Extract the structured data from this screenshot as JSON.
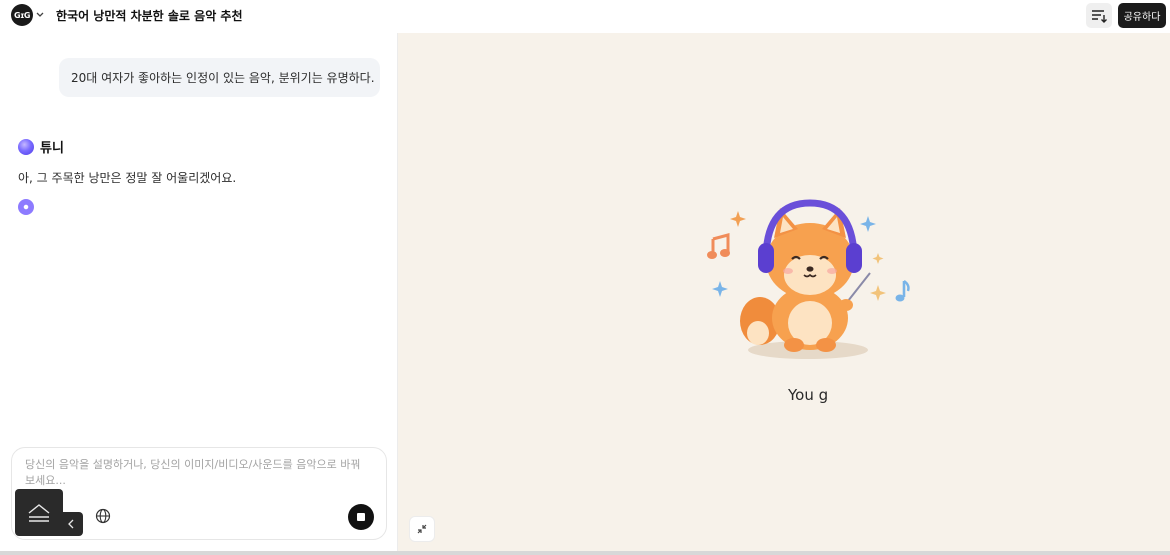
{
  "header": {
    "logo_text": "GɪG",
    "title": "한국어 낭만적 차분한 솔로 음악 추천",
    "share_label": "공유하다",
    "sort_icon": "sort-icon"
  },
  "chat": {
    "user_message": "20대 여자가 좋아하는 인정이 있는 음악, 분위기는 유명하다.",
    "bot_name": "튜니",
    "bot_message": "아, 그 주목한 낭만은 정말 잘 어울리겠어요."
  },
  "input": {
    "placeholder": "당신의 음악을 설명하거나, 당신의 이미지/비디오/사운드를 음악으로 바꿔 보세요...",
    "globe_icon": "globe-icon",
    "stop_icon": "stop-icon"
  },
  "preview": {
    "loading_text": "You g",
    "collapse_icon": "collapse-icon"
  },
  "colors": {
    "accent_purple": "#6b5cff",
    "share_bg": "#1b1b1b",
    "preview_bg": "#f7f2ea"
  }
}
